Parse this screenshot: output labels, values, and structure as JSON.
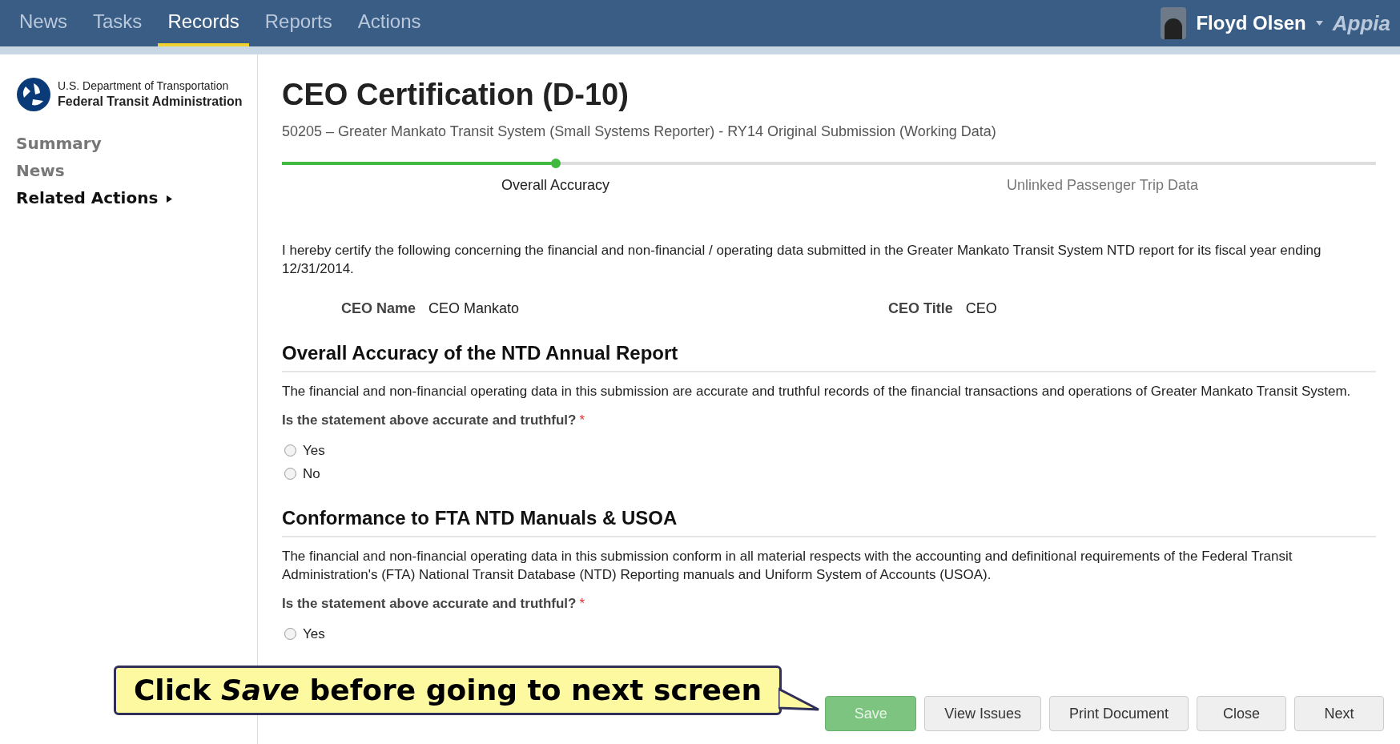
{
  "nav": {
    "tabs": [
      {
        "label": "News",
        "selected": false
      },
      {
        "label": "Tasks",
        "selected": false
      },
      {
        "label": "Records",
        "selected": true
      },
      {
        "label": "Reports",
        "selected": false
      },
      {
        "label": "Actions",
        "selected": false
      }
    ],
    "user": "Floyd Olsen",
    "brand": "Appia"
  },
  "sidebar": {
    "logo": {
      "line_1": "U.S. Department of Transportation",
      "line_2": "Federal Transit Administration"
    },
    "items": [
      {
        "label": "Summary",
        "kind": "link"
      },
      {
        "label": "News",
        "kind": "link"
      },
      {
        "label": "Related Actions",
        "kind": "menu"
      }
    ]
  },
  "page": {
    "title": "CEO Certification (D-10)",
    "subtitle": "50205 – Greater Mankato Transit System (Small Systems Reporter) - RY14 Original Submission (Working Data)",
    "progress": {
      "level": 0.25,
      "steps": [
        {
          "label": "Overall Accuracy",
          "selected": true
        },
        {
          "label": "Unlinked Passenger Trip Data",
          "selected": false
        }
      ]
    },
    "intro": "I hereby certify the following concerning the financial and non-financial / operating data submitted in the Greater Mankato Transit System NTD report for its fiscal year ending 12/31/2014.",
    "fields": [
      {
        "label": "CEO Name",
        "value": "CEO Mankato"
      },
      {
        "label": "CEO Title",
        "value": "CEO"
      }
    ],
    "sections": [
      {
        "heading": "Overall Accuracy of the NTD Annual Report",
        "text": "The financial and non-financial operating data in this submission are accurate and truthful records of the financial transactions and operations of Greater Mankato Transit System.",
        "question": "Is the statement above accurate and truthful?",
        "required_mark": "*",
        "options": [
          {
            "label": "Yes",
            "checked": false
          },
          {
            "label": "No",
            "checked": false
          }
        ]
      },
      {
        "heading": "Conformance to FTA NTD Manuals & USOA",
        "text": "The financial and non-financial operating data in this submission conform in all material respects with the accounting and definitional requirements of the Federal Transit Administration's (FTA) National Transit Database (NTD) Reporting manuals and Uniform System of Accounts (USOA).",
        "question": "Is the statement above accurate and truthful?",
        "required_mark": "*",
        "options": [
          {
            "label": "Yes",
            "checked": false
          }
        ]
      }
    ],
    "buttons": [
      {
        "label": "Save",
        "kind": "primary"
      },
      {
        "label": "View Issues",
        "kind": "secondary"
      },
      {
        "label": "Print Document",
        "kind": "secondary"
      },
      {
        "label": "Close",
        "kind": "secondary"
      },
      {
        "label": "Next",
        "kind": "secondary"
      }
    ]
  },
  "callout": {
    "text": "Click *Save* before going to next screen"
  }
}
